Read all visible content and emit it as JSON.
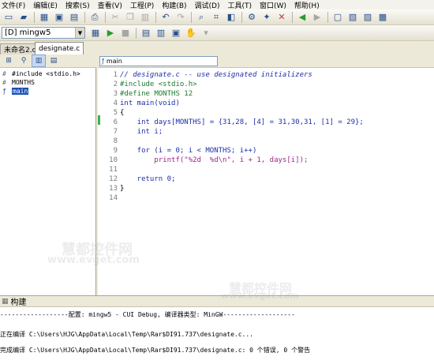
{
  "menubar": {
    "items": [
      "文件(F)",
      "编辑(E)",
      "搜索(S)",
      "查看(V)",
      "工程(P)",
      "构建(B)",
      "调试(D)",
      "工具(T)",
      "窗口(W)",
      "帮助(H)"
    ]
  },
  "toolbar2": {
    "compiler": "[D] mingw5"
  },
  "left_panel": {
    "tabs": [
      "未命名2.c*"
    ],
    "tree": [
      {
        "icon": "include-icon",
        "label": "#include <stdio.h>"
      },
      {
        "icon": "define-icon",
        "label": "MONTHS"
      },
      {
        "icon": "function-icon",
        "label": "main",
        "selected": true
      }
    ]
  },
  "editor": {
    "tab": "designate.c",
    "function": "main",
    "lines": [
      {
        "n": "1",
        "text": "// designate.c -- use designated initializers"
      },
      {
        "n": "2",
        "text": "#include <stdio.h>"
      },
      {
        "n": "3",
        "text": "#define MONTHS 12"
      },
      {
        "n": "4",
        "text": "int main(void)"
      },
      {
        "n": "5",
        "text": "{"
      },
      {
        "n": "6",
        "text": "    int days[MONTHS] = {31,28, [4] = 31,30,31, [1] = 29};"
      },
      {
        "n": "7",
        "text": "    int i;"
      },
      {
        "n": "8",
        "text": ""
      },
      {
        "n": "9",
        "text": "    for (i = 0; i < MONTHS; i++)"
      },
      {
        "n": "10",
        "text": "        printf(\"%2d  %d\\n\", i + 1, days[i]);"
      },
      {
        "n": "11",
        "text": ""
      },
      {
        "n": "12",
        "text": "    return 0;"
      },
      {
        "n": "13",
        "text": "}"
      },
      {
        "n": "14",
        "text": ""
      }
    ]
  },
  "bottom": {
    "title": "构建",
    "output": [
      "------------------配置: mingw5 - CUI Debug, 编译器类型: MinGW-------------------",
      "",
      "正在编译 C:\\Users\\HJG\\AppData\\Local\\Temp\\Rar$DI91.737\\designate.c...",
      "",
      "完成编译 C:\\Users\\HJG\\AppData\\Local\\Temp\\Rar$DI91.737\\designate.c: 0 个错误, 0 个警告"
    ]
  },
  "watermarks": [
    "慧都控件网",
    "www.evget.com",
    "慧都控件网",
    "www.evget.com"
  ]
}
